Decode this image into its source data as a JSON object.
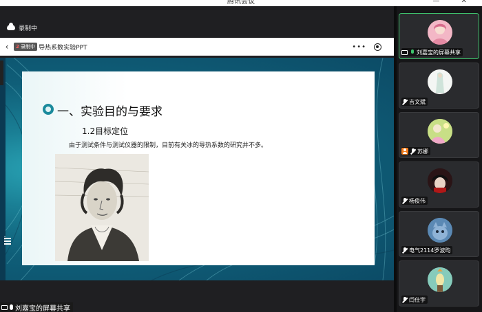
{
  "window": {
    "title": "腾讯会议",
    "controls": "—  ✕"
  },
  "recording": {
    "label": "录制中"
  },
  "ppt_toolbar": {
    "badge_num": "2",
    "badge_text": "录制中",
    "doc_name": "导热系数实验PPT",
    "back_glyph": "‹",
    "more_glyph": "•••"
  },
  "slide": {
    "heading": "一、实验目的与要求",
    "subheading": "1.2目标定位",
    "body": "由于测试条件与测试仪器的限制，目前有关冰的导热系数的研究并不多。"
  },
  "share_footer": {
    "label": "刘嘉宝的屏幕共享"
  },
  "participants": [
    {
      "name": "刘嘉宝的屏幕共享",
      "active": true,
      "icons": [
        "screen-share",
        "mic-on"
      ],
      "avatar_color": "#f3b7c6"
    },
    {
      "name": "吉文斌",
      "active": false,
      "icons": [
        "mic-muted"
      ],
      "avatar_color": "#e8f2ee"
    },
    {
      "name": "苏娜",
      "active": false,
      "icons": [
        "person",
        "mic-muted"
      ],
      "avatar_color": "#b7d56a"
    },
    {
      "name": "杨俊伟",
      "active": false,
      "icons": [
        "mic-muted"
      ],
      "avatar_color": "#2b1416"
    },
    {
      "name": "电气2114罗波昀",
      "active": false,
      "icons": [
        "mic-muted"
      ],
      "avatar_color": "#3f6f9a"
    },
    {
      "name": "闫仕宇",
      "active": false,
      "icons": [
        "mic-muted"
      ],
      "avatar_color": "#7fc9b8"
    }
  ]
}
